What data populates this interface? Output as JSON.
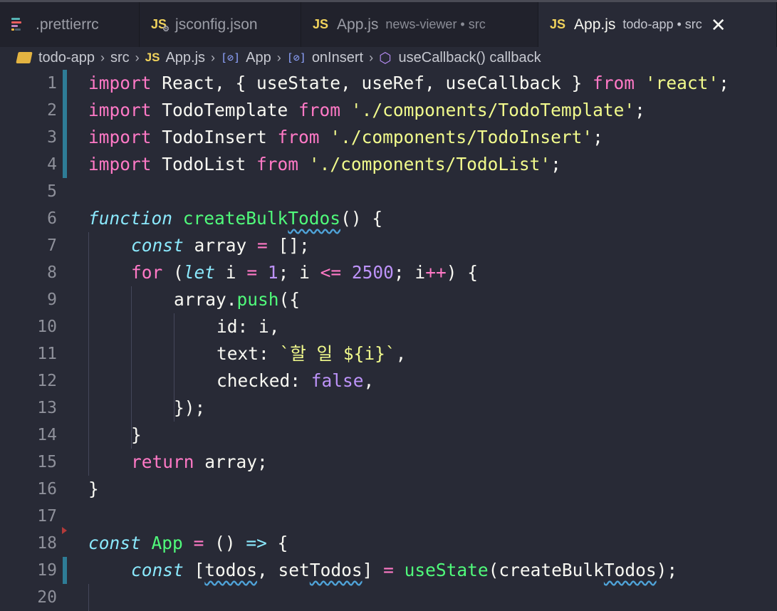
{
  "tabs": [
    {
      "label": ".prettierrc",
      "desc": ""
    },
    {
      "label": "jsconfig.json",
      "desc": ""
    },
    {
      "label": "App.js",
      "desc": "news-viewer • src"
    },
    {
      "label": "App.js",
      "desc": "todo-app • src",
      "active": true
    }
  ],
  "js_badge": "JS",
  "close_glyph": "✕",
  "breadcrumb": {
    "items": [
      "todo-app",
      "src",
      "App.js",
      "App",
      "onInsert",
      "useCallback() callback"
    ]
  },
  "editor": {
    "line_numbers": [
      "1",
      "2",
      "3",
      "4",
      "5",
      "6",
      "7",
      "8",
      "9",
      "10",
      "11",
      "12",
      "13",
      "14",
      "15",
      "16",
      "17",
      "18",
      "19",
      "20"
    ],
    "lines": {
      "l1": {
        "t1": "import",
        "t2": " React, { useState, useRef, useCallback } ",
        "t3": "from",
        "t4": " ",
        "t5": "'react'",
        "t6": ";"
      },
      "l2": {
        "t1": "import",
        "t2": " TodoTemplate ",
        "t3": "from",
        "t4": " ",
        "t5": "'./components/TodoTemplate'",
        "t6": ";"
      },
      "l3": {
        "t1": "import",
        "t2": " TodoInsert ",
        "t3": "from",
        "t4": " ",
        "t5": "'./components/TodoInsert'",
        "t6": ";"
      },
      "l4": {
        "t1": "import",
        "t2": " TodoList ",
        "t3": "from",
        "t4": " ",
        "t5": "'./components/TodoList'",
        "t6": ";"
      },
      "l6": {
        "t1": "function",
        "t2": " ",
        "t3": "createBulk",
        "t4": "Todos",
        "t5": "() {"
      },
      "l7": {
        "t1": "const",
        "t2": " array ",
        "t3": "=",
        "t4": " [];"
      },
      "l8": {
        "t1": "for",
        "t2": " (",
        "t3": "let",
        "t4": " i ",
        "t5": "=",
        "t6": " ",
        "t7": "1",
        "t8": "; i ",
        "t9": "<=",
        "t10": " ",
        "t11": "2500",
        "t12": "; i",
        "t13": "++",
        "t14": ") {"
      },
      "l9": {
        "t1": "array.",
        "t2": "push",
        "t3": "({"
      },
      "l10": {
        "t1": "id: i,"
      },
      "l11": {
        "t1": "text: ",
        "t2": "`할 일 ",
        "t3": "${",
        "t4": "i",
        "t5": "}",
        "t6": "`",
        "t7": ","
      },
      "l12": {
        "t1": "checked: ",
        "t2": "false",
        "t3": ","
      },
      "l13": {
        "t1": "});"
      },
      "l14": {
        "t1": "}"
      },
      "l15": {
        "t1": "return",
        "t2": " array;"
      },
      "l16": {
        "t1": "}"
      },
      "l18": {
        "t1": "const",
        "t2": " ",
        "t3": "App",
        "t4": " ",
        "t5": "=",
        "t6": " () ",
        "t7": "=>",
        "t8": " {"
      },
      "l19": {
        "t1": "const",
        "t2": " [",
        "t3": "todos",
        "t4": ", set",
        "t5": "Todos",
        "t6": "] ",
        "t7": "=",
        "t8": " ",
        "t9": "useState",
        "t10": "(createBulk",
        "t11": "Todos",
        "t12": ");"
      }
    }
  },
  "colors": {
    "background": "#282a36",
    "keyword": "#ff79c6",
    "string": "#f1fa8c",
    "storage": "#8be9fd",
    "function": "#50fa7b",
    "number": "#bd93f9",
    "modified_gutter": "#2e7c96"
  },
  "icons": [
    "prettier-icon",
    "json-settings-icon",
    "js-file-icon",
    "close-icon",
    "folder-icon",
    "chevron-right-icon",
    "symbol-variable-icon",
    "symbol-method-icon"
  ]
}
